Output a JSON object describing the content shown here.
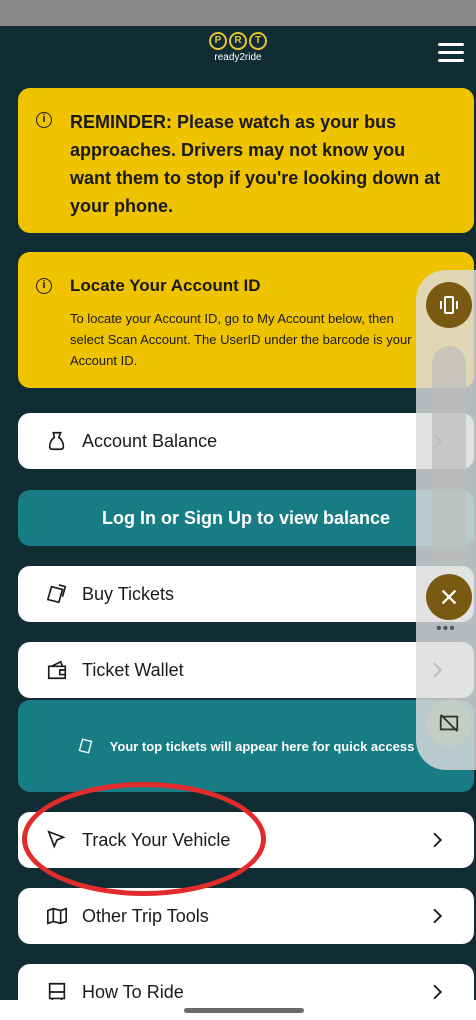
{
  "header": {
    "logo_letters": [
      "P",
      "R",
      "T"
    ],
    "logo_word": "ready2ride"
  },
  "reminder": {
    "text": "REMINDER: Please watch as your bus approaches. Drivers may not know you want them to stop if you're looking down at your phone."
  },
  "locate": {
    "title": "Locate Your Account ID",
    "body": "To locate your Account ID, go to My Account below, then select Scan Account. The UserID under the barcode is your Account ID."
  },
  "menu": {
    "account_balance": "Account Balance",
    "login_prompt": "Log In or Sign Up to view balance",
    "buy_tickets": "Buy Tickets",
    "ticket_wallet": "Ticket Wallet",
    "quick_access": "Your top tickets will appear here for quick access",
    "track_vehicle": "Track Your Vehicle",
    "other_trip_tools": "Other Trip Tools",
    "how_to_ride": "How To Ride"
  },
  "colors": {
    "background": "#0f2d33",
    "yellow": "#f0c300",
    "teal": "#177c84",
    "highlight": "#e32b2b"
  }
}
